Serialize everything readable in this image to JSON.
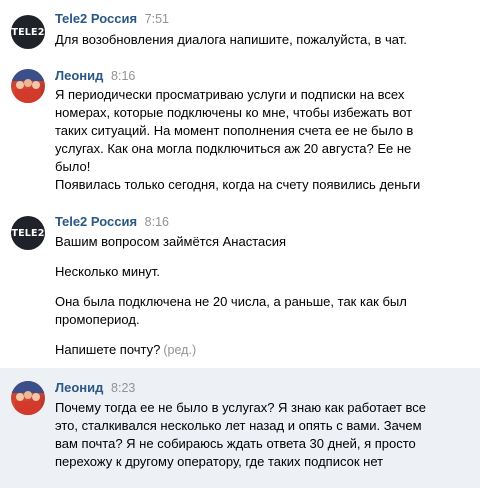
{
  "messages": [
    {
      "author": "Tele2 Россия",
      "avatar_text": "TELE2",
      "time": "7:51",
      "lines": [
        "Для возобновления диалога напишите, пожалуйста, в чат."
      ]
    },
    {
      "author": "Леонид",
      "time": "8:16",
      "lines": [
        "Я периодически просматриваю услуги и подписки на всех",
        "номерах, которые подключены ко мне, чтобы избежать вот",
        "таких ситуаций. На момент пополнения счета ее не было в",
        "услугах. Как она могла подключиться аж 20 августа? Ее не",
        "было!",
        "Появилась только сегодня, когда на счету появились деньги"
      ]
    },
    {
      "author": "Tele2 Россия",
      "avatar_text": "TELE2",
      "time": "8:16",
      "paragraphs": [
        [
          "Вашим вопросом займётся Анастасия"
        ],
        [
          "Несколько минут."
        ],
        [
          "Она была подключена не 20 числа, а раньше, так как был",
          "промопериод."
        ],
        [
          "Напишете почту?"
        ]
      ],
      "edited_label": "(ред.)"
    },
    {
      "author": "Леонид",
      "time": "8:23",
      "lines": [
        "Почему тогда ее не было в услугах? Я знаю как работает все",
        "это, сталкивался несколько лет назад и опять с вами. Зачем",
        "вам почта? Я не собираюсь ждать ответа 30 дней, я просто",
        "перехожу к другому оператору, где таких подписок нет"
      ]
    }
  ]
}
